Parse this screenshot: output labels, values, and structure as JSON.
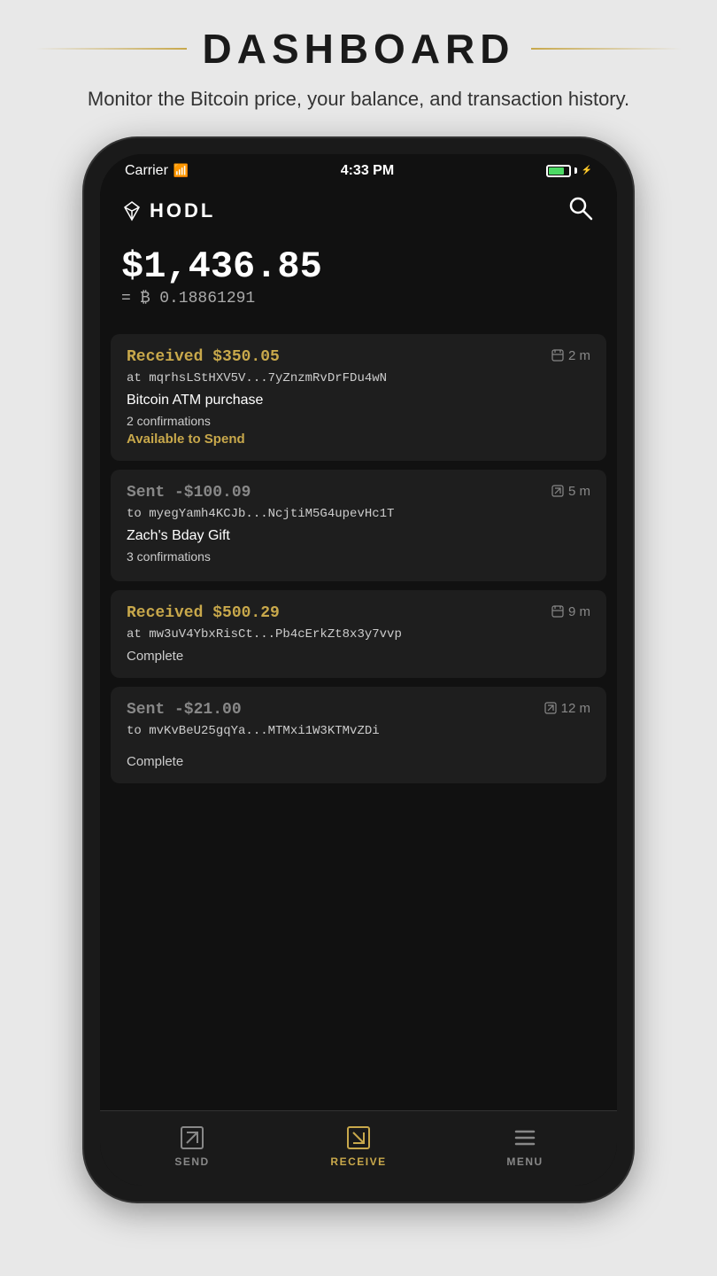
{
  "page": {
    "title": "DASHBOARD",
    "subtitle": "Monitor the Bitcoin price, your balance, and transaction history."
  },
  "statusBar": {
    "carrier": "Carrier",
    "time": "4:33 PM",
    "batteryFill": "80%"
  },
  "app": {
    "logoText": "HODL",
    "balanceUSD": "$1,436.85",
    "balanceBTC": "= ₿ 0.18861291"
  },
  "transactions": [
    {
      "id": "tx1",
      "type": "received",
      "amount": "Received $350.05",
      "address": "at mqrhsLStHXV5V...7yZnzmRvDrFDu4wN",
      "time": "2 m",
      "label": "Bitcoin ATM purchase",
      "confirmations": "2 confirmations",
      "status": "Available to Spend",
      "statusType": "available"
    },
    {
      "id": "tx2",
      "type": "sent",
      "amount": "Sent -$100.09",
      "address": "to myegYamh4KCJb...NcjtiM5G4upevHc1T",
      "time": "5 m",
      "label": "Zach's Bday Gift",
      "confirmations": "3 confirmations",
      "status": "",
      "statusType": "none"
    },
    {
      "id": "tx3",
      "type": "received",
      "amount": "Received $500.29",
      "address": "at mw3uV4YbxRisCt...Pb4cErkZt8x3y7vvp",
      "time": "9 m",
      "label": "",
      "confirmations": "",
      "status": "Complete",
      "statusType": "complete"
    },
    {
      "id": "tx4",
      "type": "sent",
      "amount": "Sent -$21.00",
      "address": "to mvKvBeU25gqYa...MTMxi1W3KTMvZDi",
      "time": "12 m",
      "label": "",
      "confirmations": "",
      "status": "Complete",
      "statusType": "complete"
    }
  ],
  "bottomNav": {
    "send": "SEND",
    "receive": "RECEIVE",
    "menu": "MENU"
  }
}
